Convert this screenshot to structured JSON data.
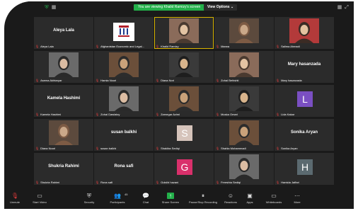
{
  "topbar": {
    "share_banner": "You are viewing Khalid Ramizy's screen",
    "view_options": "View Options ⌄"
  },
  "tiles": [
    {
      "label": "Aleya Lala",
      "name": "Aleya Lala",
      "kind": "name"
    },
    {
      "label": "Afghanistan Economic and Legal...",
      "kind": "logo"
    },
    {
      "label": "Khalid Ramizy",
      "kind": "photo",
      "spotlight": true
    },
    {
      "label": "Marwa",
      "kind": "photo"
    },
    {
      "label": "Salima Ahmadi",
      "kind": "photo"
    },
    {
      "label": "Asema Akhtaryar",
      "kind": "photo"
    },
    {
      "label": "Hamia Noori",
      "kind": "photo"
    },
    {
      "label": "Diana Nori",
      "kind": "photo"
    },
    {
      "label": "Zohal Behishti",
      "kind": "photo"
    },
    {
      "label": "Mary hasanzada",
      "name": "Mary hasanzada",
      "kind": "name"
    },
    {
      "label": "Kamela Hashimi",
      "name": "Kamela Hashimi",
      "kind": "name"
    },
    {
      "label": "Zohal Dawlatzy",
      "kind": "photo"
    },
    {
      "label": "Zarnegar Azimi",
      "kind": "photo"
    },
    {
      "label": "Muska Omari",
      "kind": "photo"
    },
    {
      "label": "Lida Kakar",
      "letter": "L",
      "color": "#7a4fc2",
      "kind": "letter"
    },
    {
      "label": "Diana Noori",
      "kind": "photo"
    },
    {
      "label": "susan balkhi",
      "name": "susan balkhi",
      "kind": "name"
    },
    {
      "label": "Shakiba Sediqi",
      "letter": "S",
      "color": "#d6c4bb",
      "kind": "letter"
    },
    {
      "label": "Shahla Mohammadi",
      "kind": "photo"
    },
    {
      "label": "Sonika Aryan",
      "name": "Sonika Aryan",
      "kind": "name"
    },
    {
      "label": "Shukria Rahimi",
      "name": "Shukria Rahimi",
      "kind": "name"
    },
    {
      "label": "Rona safi",
      "name": "Rona safi",
      "kind": "name"
    },
    {
      "label": "Gulsibi hazani",
      "letter": "G",
      "color": "#d9306b",
      "kind": "letter"
    },
    {
      "label": "Fereshta Sediqi",
      "kind": "photo"
    },
    {
      "label": "Hamida Jaffari",
      "letter": "H",
      "color": "#5b6a70",
      "kind": "letter"
    }
  ],
  "bottombar": {
    "unmute": "Unmute",
    "start_video": "Start Video",
    "security": "Security",
    "participants": "Participants",
    "participants_count": "45",
    "chat": "Chat",
    "share_screen": "Share Screen",
    "record": "Pause/Stop Recording",
    "reactions": "Reactions",
    "apps": "Apps",
    "whiteboards": "Whiteboards",
    "more": "More"
  },
  "colors": {
    "accent": "#23b04a",
    "mic_muted": "#e23b3b",
    "spotlight": "#d8b400"
  }
}
